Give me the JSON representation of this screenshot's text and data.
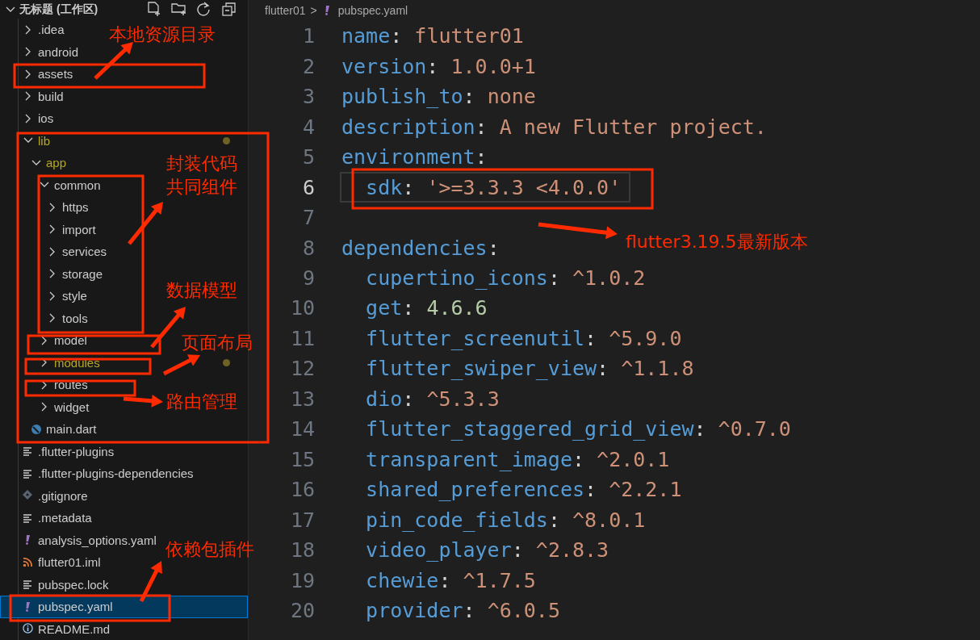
{
  "sidebar": {
    "title": "无标题 (工作区)",
    "expanded": true,
    "tree": [
      {
        "label": ".idea",
        "kind": "folder",
        "expanded": false,
        "modified": false,
        "selected": false
      },
      {
        "label": "android",
        "kind": "folder",
        "expanded": false,
        "modified": false,
        "selected": false
      },
      {
        "label": "assets",
        "kind": "folder",
        "expanded": false,
        "modified": false,
        "selected": false
      },
      {
        "label": "build",
        "kind": "folder",
        "expanded": false,
        "modified": false,
        "selected": false
      },
      {
        "label": "ios",
        "kind": "folder",
        "expanded": false,
        "modified": false,
        "selected": false
      },
      {
        "label": "lib",
        "kind": "folder",
        "expanded": true,
        "modified": true,
        "selected": false,
        "children": [
          {
            "label": "app",
            "kind": "folder",
            "expanded": true,
            "modified": true,
            "selected": false,
            "children": [
              {
                "label": "common",
                "kind": "folder",
                "expanded": true,
                "modified": false,
                "selected": false,
                "children": [
                  {
                    "label": "https",
                    "kind": "folder",
                    "expanded": false,
                    "modified": false,
                    "selected": false
                  },
                  {
                    "label": "import",
                    "kind": "folder",
                    "expanded": false,
                    "modified": false,
                    "selected": false
                  },
                  {
                    "label": "services",
                    "kind": "folder",
                    "expanded": false,
                    "modified": false,
                    "selected": false
                  },
                  {
                    "label": "storage",
                    "kind": "folder",
                    "expanded": false,
                    "modified": false,
                    "selected": false
                  },
                  {
                    "label": "style",
                    "kind": "folder",
                    "expanded": false,
                    "modified": false,
                    "selected": false
                  },
                  {
                    "label": "tools",
                    "kind": "folder",
                    "expanded": false,
                    "modified": false,
                    "selected": false
                  }
                ]
              },
              {
                "label": "model",
                "kind": "folder",
                "expanded": false,
                "modified": false,
                "selected": false
              },
              {
                "label": "modules",
                "kind": "folder",
                "expanded": false,
                "modified": true,
                "selected": false
              },
              {
                "label": "routes",
                "kind": "folder",
                "expanded": false,
                "modified": false,
                "selected": false
              },
              {
                "label": "widget",
                "kind": "folder",
                "expanded": false,
                "modified": false,
                "selected": false
              }
            ]
          },
          {
            "label": "main.dart",
            "kind": "dart",
            "modified": false,
            "selected": false
          }
        ]
      },
      {
        "label": ".flutter-plugins",
        "kind": "text",
        "modified": false,
        "selected": false
      },
      {
        "label": ".flutter-plugins-dependencies",
        "kind": "text",
        "modified": false,
        "selected": false
      },
      {
        "label": ".gitignore",
        "kind": "git",
        "modified": false,
        "selected": false
      },
      {
        "label": ".metadata",
        "kind": "text",
        "modified": false,
        "selected": false
      },
      {
        "label": "analysis_options.yaml",
        "kind": "yaml",
        "modified": false,
        "selected": false
      },
      {
        "label": "flutter01.iml",
        "kind": "rss",
        "modified": false,
        "selected": false
      },
      {
        "label": "pubspec.lock",
        "kind": "text",
        "modified": false,
        "selected": false
      },
      {
        "label": "pubspec.yaml",
        "kind": "yaml",
        "modified": false,
        "selected": true
      },
      {
        "label": "README.md",
        "kind": "info",
        "modified": false,
        "selected": false
      }
    ]
  },
  "editor": {
    "breadcrumb": {
      "folder": "flutter01",
      "separator": ">",
      "file": "pubspec.yaml"
    },
    "lines": [
      {
        "number": "1",
        "key": "name",
        "separator": ":",
        "value": "flutter01",
        "kind": "string",
        "current": false
      },
      {
        "number": "2",
        "key": "version",
        "separator": ":",
        "value": "1.0.0+1",
        "kind": "string",
        "current": false
      },
      {
        "number": "3",
        "key": "publish_to",
        "separator": ":",
        "value": "none",
        "kind": "string",
        "current": false
      },
      {
        "number": "4",
        "key": "description",
        "separator": ":",
        "value": "A new Flutter project.",
        "kind": "string",
        "current": false
      },
      {
        "number": "5",
        "key": "environment",
        "separator": ":",
        "kind": "section",
        "current": false,
        "children": [
          {
            "number": "6",
            "key": "sdk",
            "separator": ":",
            "value": "'>=3.3.3 <4.0.0'",
            "kind": "string",
            "current": true
          }
        ]
      },
      {
        "number": "7",
        "kind": "blank",
        "current": false
      },
      {
        "number": "8",
        "key": "dependencies",
        "separator": ":",
        "kind": "section",
        "current": false,
        "children": [
          {
            "number": "9",
            "key": "cupertino_icons",
            "separator": ":",
            "value": "^1.0.2",
            "kind": "string",
            "current": false
          },
          {
            "number": "10",
            "key": "get",
            "separator": ":",
            "value": "4.6.6",
            "kind": "number",
            "current": false
          },
          {
            "number": "11",
            "key": "flutter_screenutil",
            "separator": ":",
            "value": "^5.9.0",
            "kind": "string",
            "current": false
          },
          {
            "number": "12",
            "key": "flutter_swiper_view",
            "separator": ":",
            "value": "^1.1.8",
            "kind": "string",
            "current": false
          },
          {
            "number": "13",
            "key": "dio",
            "separator": ":",
            "value": "^5.3.3",
            "kind": "string",
            "current": false
          },
          {
            "number": "14",
            "key": "flutter_staggered_grid_view",
            "separator": ":",
            "value": "^0.7.0",
            "kind": "string",
            "current": false
          },
          {
            "number": "15",
            "key": "transparent_image",
            "separator": ":",
            "value": "^2.0.1",
            "kind": "string",
            "current": false
          },
          {
            "number": "16",
            "key": "shared_preferences",
            "separator": ":",
            "value": "^2.2.1",
            "kind": "string",
            "current": false
          },
          {
            "number": "17",
            "key": "pin_code_fields",
            "separator": ":",
            "value": "^8.0.1",
            "kind": "string",
            "current": false
          },
          {
            "number": "18",
            "key": "video_player",
            "separator": ":",
            "value": "^2.8.3",
            "kind": "string",
            "current": false
          },
          {
            "number": "19",
            "key": "chewie",
            "separator": ":",
            "value": "^1.7.5",
            "kind": "string",
            "current": false
          },
          {
            "number": "20",
            "key": "provider",
            "separator": ":",
            "value": "^6.0.5",
            "kind": "string",
            "current": false
          }
        ]
      }
    ]
  },
  "annotations": [
    {
      "lines": [
        "本地资源目录"
      ]
    },
    {
      "lines": [
        "封装代码",
        "共同组件"
      ]
    },
    {
      "lines": [
        "数据模型"
      ]
    },
    {
      "lines": [
        "页面布局"
      ]
    },
    {
      "lines": [
        "路由管理"
      ]
    },
    {
      "lines": [
        "flutter3.19.5最新版本"
      ]
    },
    {
      "lines": [
        "依赖包插件"
      ]
    }
  ]
}
